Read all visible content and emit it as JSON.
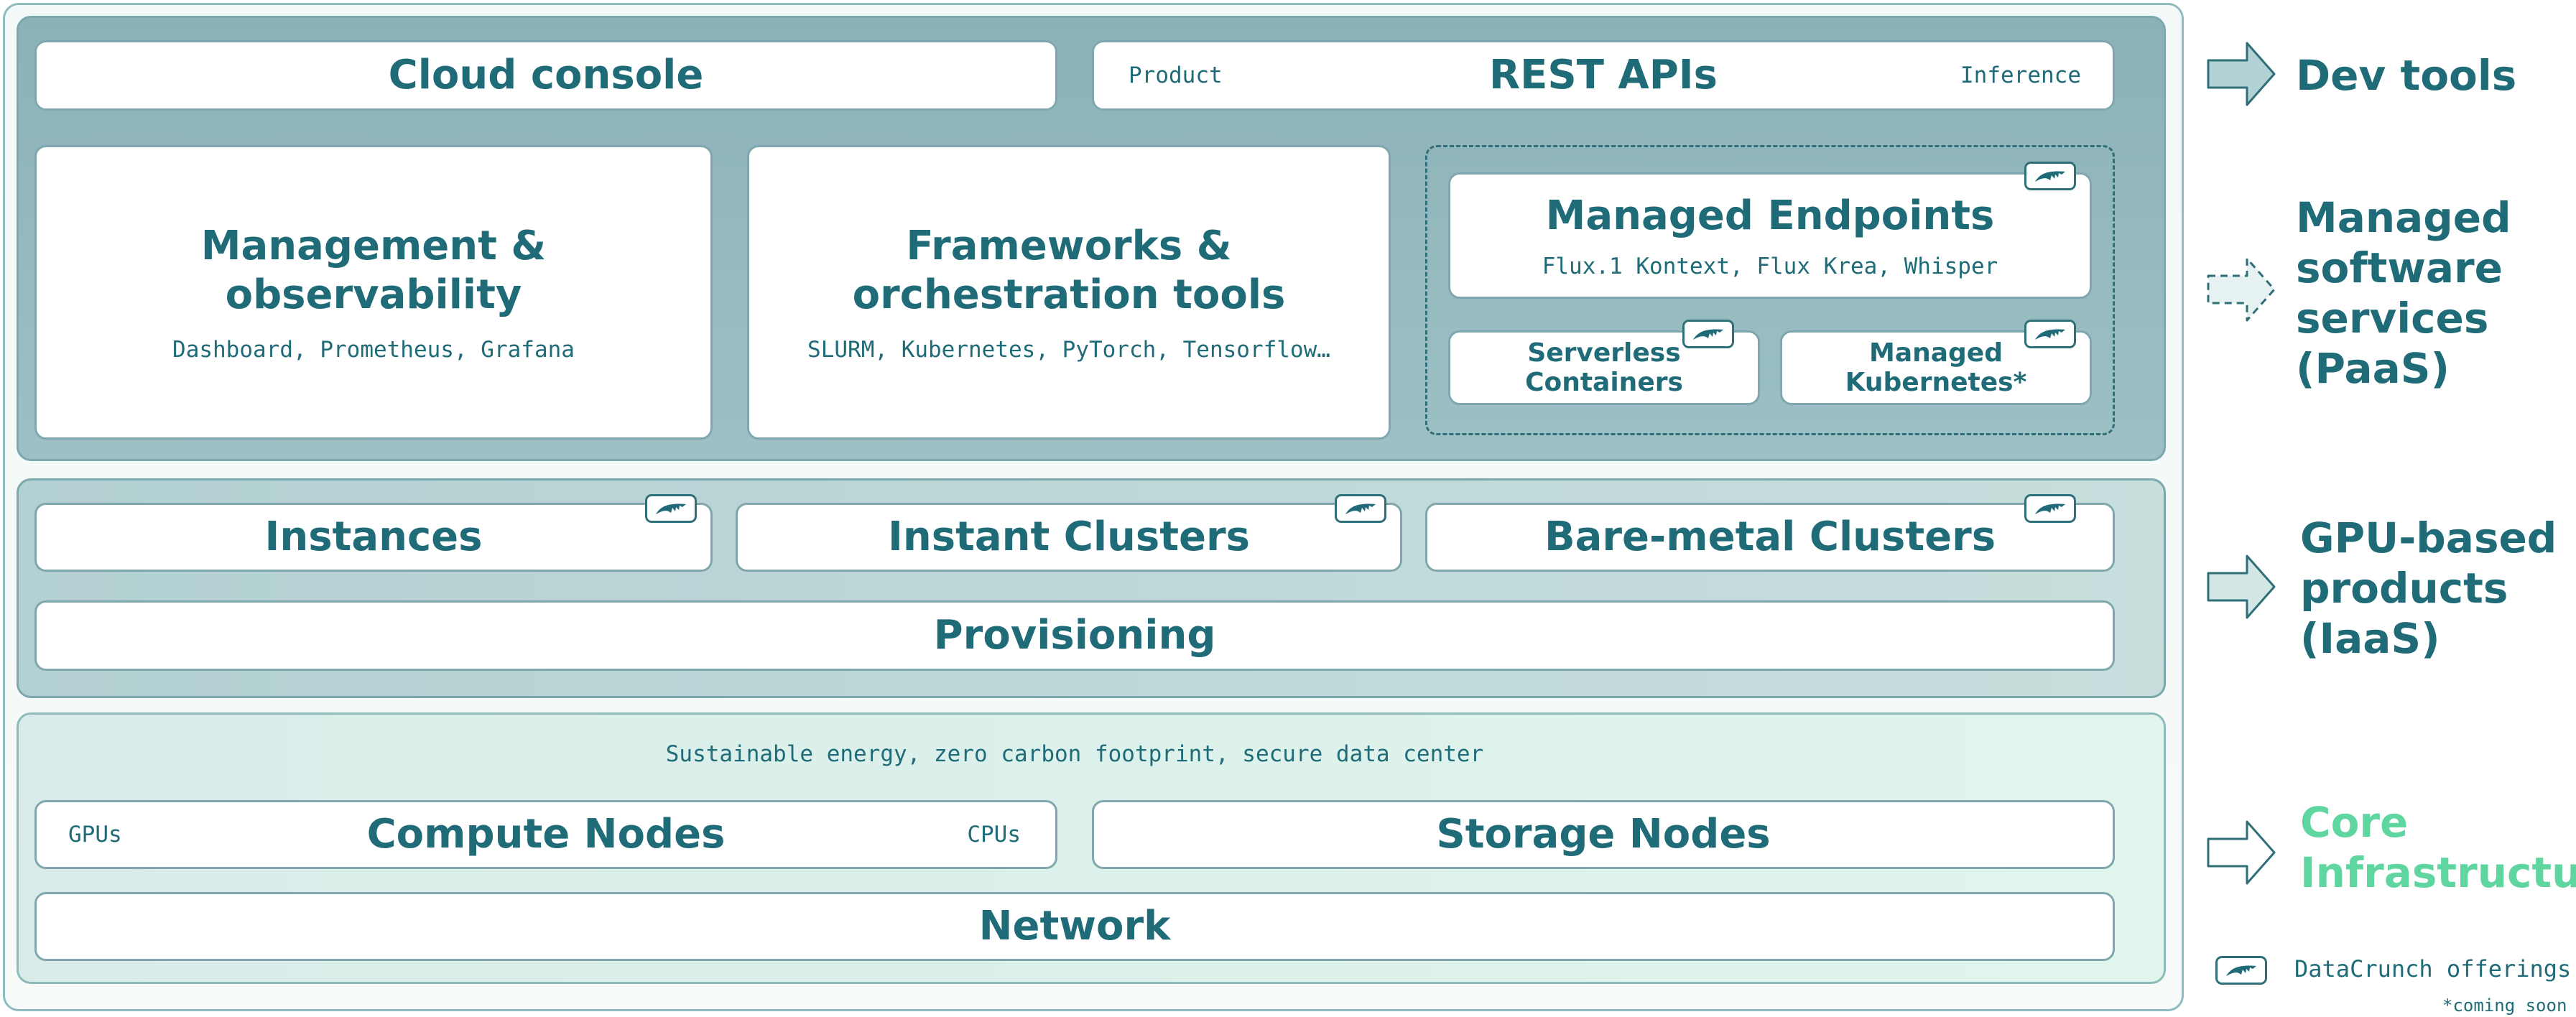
{
  "stack": {
    "dev": {
      "cloud_console": "Cloud console",
      "rest_apis": "REST APIs",
      "rest_left": "Product",
      "rest_right": "Inference"
    },
    "paas": {
      "management": {
        "title": "Management & observability",
        "subtitle": "Dashboard, Prometheus, Grafana"
      },
      "frameworks": {
        "title": "Frameworks & orchestration tools",
        "subtitle": "SLURM, Kubernetes, PyTorch, Tensorflow…"
      },
      "managed_endpoints": {
        "title": "Managed Endpoints",
        "subtitle": "Flux.1 Kontext, Flux Krea, Whisper"
      },
      "serverless": "Serverless Containers",
      "managed_k8s": "Managed Kubernetes*"
    },
    "iaas": {
      "instances": "Instances",
      "instant_clusters": "Instant Clusters",
      "bare_metal": "Bare-metal Clusters",
      "provisioning": "Provisioning"
    },
    "core": {
      "banner": "Sustainable energy, zero carbon footprint, secure data center",
      "compute": "Compute Nodes",
      "compute_left": "GPUs",
      "compute_right": "CPUs",
      "storage": "Storage Nodes",
      "network": "Network"
    }
  },
  "side_labels": {
    "dev_tools": "Dev tools",
    "paas": [
      "Managed",
      "software",
      "services",
      "(PaaS)"
    ],
    "iaas": [
      "GPU-based",
      "products",
      "(IaaS)"
    ],
    "core": [
      "Core",
      "Infrastructure"
    ]
  },
  "legend": {
    "offerings": "DataCrunch offerings",
    "coming_soon": "*coming soon"
  },
  "colors": {
    "text": "#1f6b78",
    "core_accent": "#5fd6a0",
    "layer_paas": "#8bb2b9",
    "layer_iaas": "#b3d0d2",
    "layer_core": "#dcf2ea"
  },
  "icons": {
    "badge": "datacrunch-logo-icon"
  }
}
